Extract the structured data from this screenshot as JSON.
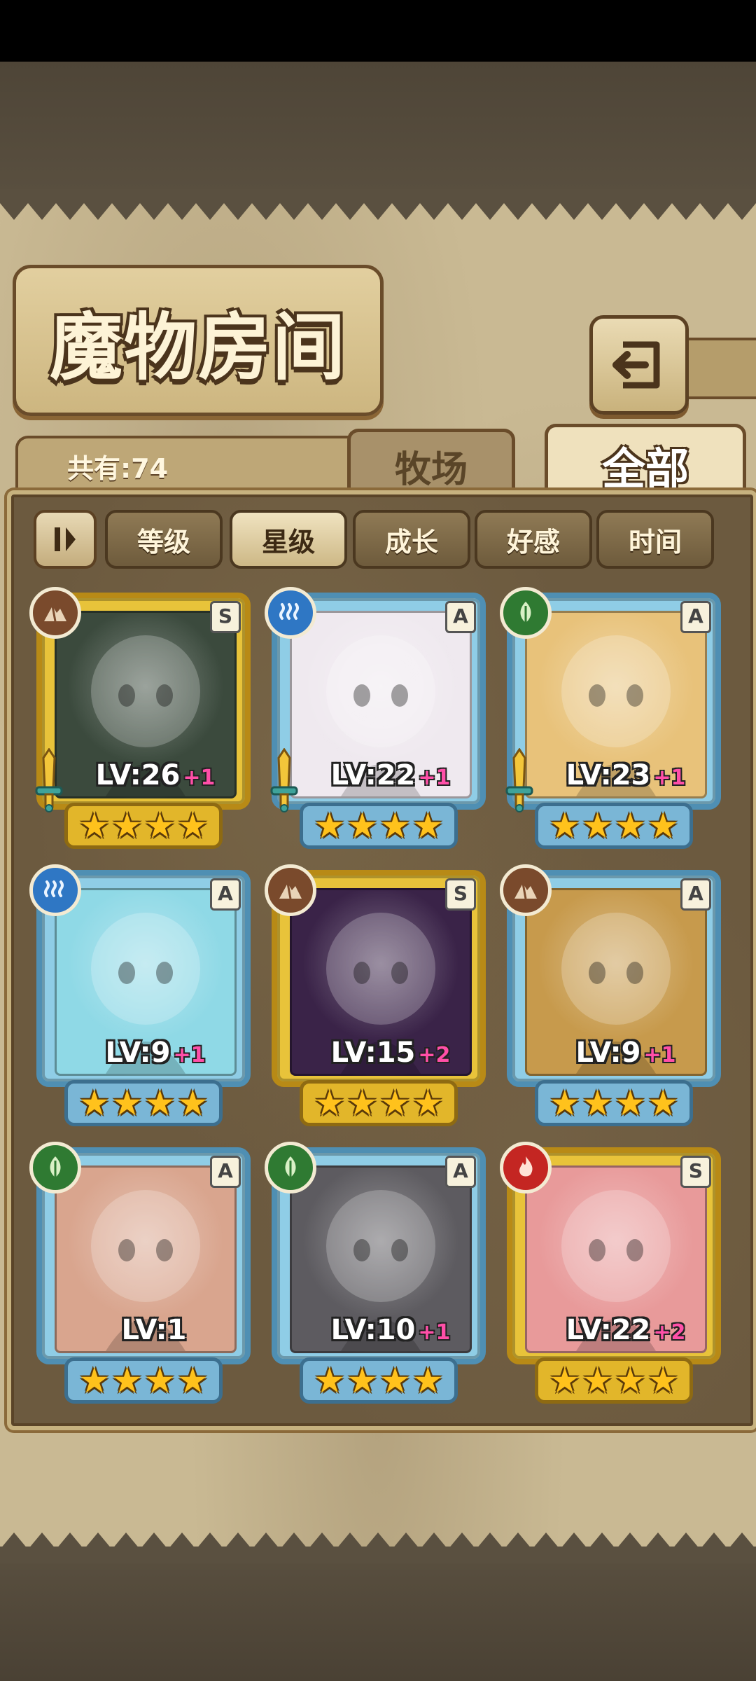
{
  "title": "魔物房间",
  "count_label": "共有:74",
  "tabs": [
    {
      "label": "牧场",
      "active": false
    },
    {
      "label": "全部",
      "active": true
    }
  ],
  "sort_buttons": [
    {
      "label": "等级",
      "active": false
    },
    {
      "label": "星级",
      "active": true
    },
    {
      "label": "成长",
      "active": false
    },
    {
      "label": "好感",
      "active": false
    },
    {
      "label": "时间",
      "active": false
    }
  ],
  "cards": [
    {
      "rank": "S",
      "element": "earth-icon",
      "level": "LV:26",
      "bonus": "+1",
      "stars": 4,
      "sword": true,
      "frame": "gold",
      "bg": "#3b4a3d"
    },
    {
      "rank": "A",
      "element": "water-icon",
      "level": "LV:22",
      "bonus": "+1",
      "stars": 4,
      "sword": true,
      "frame": "blue",
      "bg": "#efe9ef"
    },
    {
      "rank": "A",
      "element": "wood-icon",
      "level": "LV:23",
      "bonus": "+1",
      "stars": 4,
      "sword": true,
      "frame": "blue",
      "bg": "#e8c27a"
    },
    {
      "rank": "A",
      "element": "water-icon",
      "level": "LV:9",
      "bonus": "+1",
      "stars": 4,
      "sword": false,
      "frame": "blue",
      "bg": "#8fd9e6"
    },
    {
      "rank": "S",
      "element": "earth-icon",
      "level": "LV:15",
      "bonus": "+2",
      "stars": 4,
      "sword": false,
      "frame": "gold",
      "bg": "#3a2348"
    },
    {
      "rank": "A",
      "element": "earth-icon",
      "level": "LV:9",
      "bonus": "+1",
      "stars": 4,
      "sword": false,
      "frame": "blue",
      "bg": "#c79a4c"
    },
    {
      "rank": "A",
      "element": "wood-icon",
      "level": "LV:1",
      "bonus": "",
      "stars": 4,
      "sword": false,
      "frame": "blue",
      "bg": "#d9a58e"
    },
    {
      "rank": "A",
      "element": "wood-icon",
      "level": "LV:10",
      "bonus": "+1",
      "stars": 4,
      "sword": false,
      "frame": "blue",
      "bg": "#5d5b60"
    },
    {
      "rank": "S",
      "element": "fire-icon",
      "level": "LV:22",
      "bonus": "+2",
      "stars": 4,
      "sword": false,
      "frame": "gold",
      "bg": "#e89a9a"
    }
  ]
}
